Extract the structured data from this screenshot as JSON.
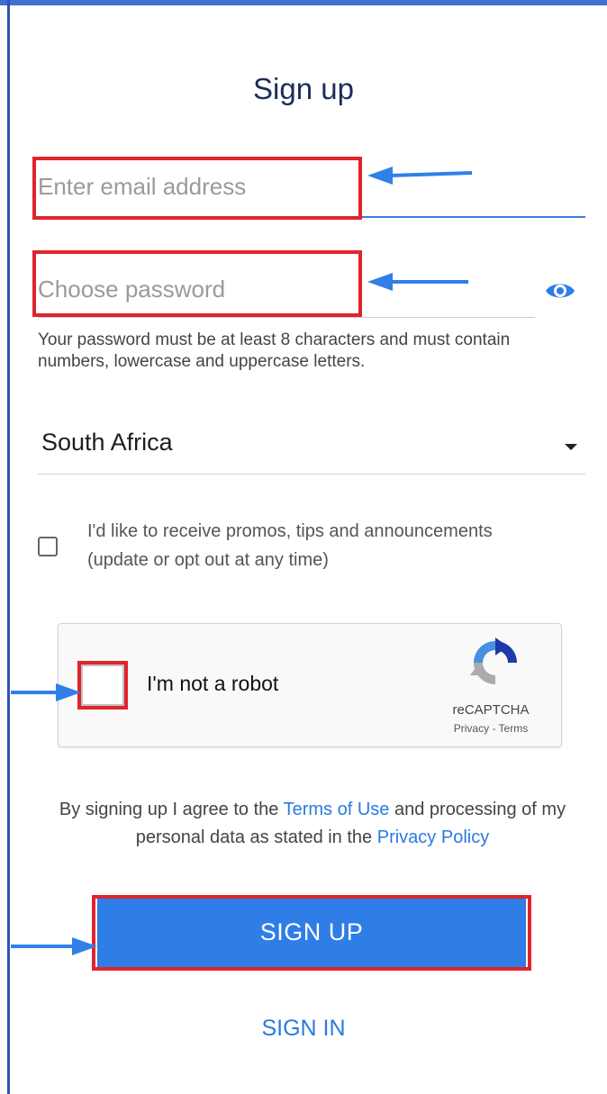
{
  "form": {
    "title": "Sign up",
    "email_placeholder": "Enter email address",
    "password_placeholder": "Choose password",
    "password_hint": "Your password must be at least 8 characters and must contain numbers, lowercase and uppercase letters.",
    "country": "South Africa",
    "promo_label": "I'd like to receive promos, tips and announcements (update or opt out at any time)",
    "recaptcha": {
      "label": "I'm not a robot",
      "brand": "reCAPTCHA",
      "links": "Privacy - Terms"
    },
    "agreement": {
      "part1": "By signing up I agree to the ",
      "terms": "Terms of Use",
      "part2": " and processing of my personal data as stated in the ",
      "privacy": "Privacy Policy"
    },
    "signup_label": "SIGN UP",
    "signin_label": "SIGN IN"
  },
  "colors": {
    "accent": "#2f7de6",
    "annotation_red": "#e0242c",
    "annotation_arrow": "#2f80e8"
  },
  "icons": [
    "eye-icon",
    "dropdown-icon",
    "recaptcha-logo",
    "arrow-icon"
  ]
}
